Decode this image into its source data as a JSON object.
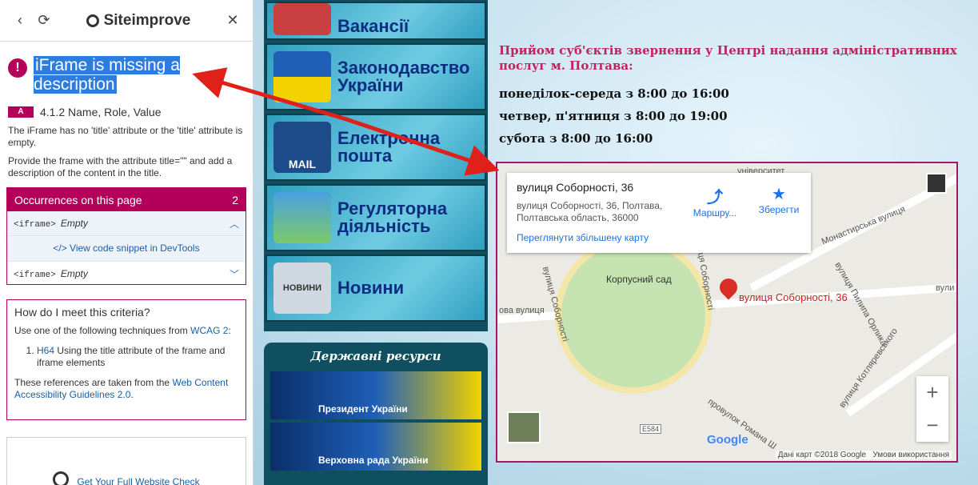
{
  "siteimprove": {
    "brand": "Siteimprove",
    "issue_title": "iFrame is missing a description",
    "level": "A",
    "criterion": "4.1.2 Name, Role, Value",
    "desc1": "The iFrame has no 'title' attribute or the 'title' attribute is empty.",
    "desc2": "Provide the frame with the attribute title=\"\" and add a description of the content in the title.",
    "occurrences_label": "Occurrences on this page",
    "occurrences_count": "2",
    "occ_tag": "<iframe>",
    "occ_value": "Empty",
    "view_snippet": "</> View code snippet in DevTools",
    "how_title": "How do I meet this criteria?",
    "how_intro": "Use one of the following techniques from",
    "how_intro_link": "WCAG 2",
    "technique_link": "H64",
    "technique_text": "Using the title attribute of the frame and iframe elements",
    "refs_text": "These references are taken from the",
    "refs_link": "Web Content Accessibility Guidelines 2.0",
    "promo": "Get Your Full Website Check"
  },
  "site": {
    "menu": [
      "Вакансії",
      "Законодавство України",
      "Електронна пошта",
      "Регуляторна діяльність",
      "Новини"
    ],
    "mail_badge": "MAIL",
    "news_badge": "НОВИНИ",
    "resources_title": "Державні ресурси",
    "banners": [
      "Президент України",
      "Верховна рада України"
    ],
    "info_title": "Прийом суб'єктів звернення у Центрі надання адміністративних послуг м. Полтава:",
    "hours": [
      "понеділок-середа з 8:00 до 16:00",
      "четвер, п'ятниця з 8:00 до 19:00",
      "субота з 8:00 до 16:00"
    ]
  },
  "map": {
    "place_name": "вулиця Соборності, 36",
    "address": "вулиця Соборності, 36, Полтава, Полтавська область, 36000",
    "directions": "Маршру...",
    "save": "Зберегти",
    "larger_map": "Переглянути збільшену карту",
    "pin_label": "вулиця Соборності, 36",
    "park": "Корпусний сад",
    "streets": [
      "університет",
      "Монастирська вулиця",
      "вулиця Соборності",
      "вулиця Соборності",
      "вулиця Пилипа Орлика",
      "вулиця Котляревського",
      "провулок Романа Ш",
      "ова вулиця",
      "вули"
    ],
    "road_badge": "E584",
    "google": "Google",
    "attribution": "Дані карт ©2018 Google",
    "terms": "Умови використання",
    "zoom_in": "+",
    "zoom_out": "−"
  },
  "colors": {
    "accent": "#b5005b",
    "highlight": "#2d7de0",
    "map_border": "#9c1a68"
  }
}
